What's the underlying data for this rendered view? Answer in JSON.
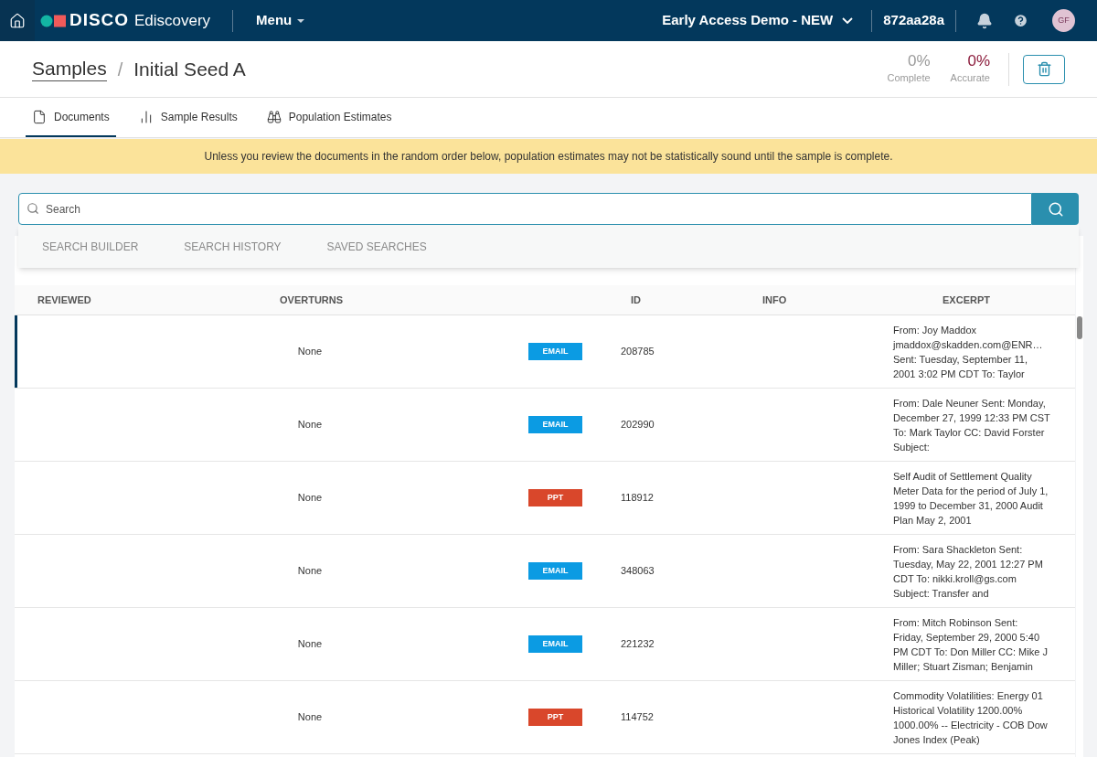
{
  "topbar": {
    "brand": "DISCO",
    "product": "Ediscovery",
    "menu": "Menu",
    "workspace": "Early Access Demo - NEW",
    "case_id": "872aa28a",
    "avatar": "GF"
  },
  "header": {
    "breadcrumb": "Samples",
    "separator": "/",
    "title": "Initial Seed A",
    "stats": [
      {
        "value": "0%",
        "label": "Complete",
        "kind": "neutral"
      },
      {
        "value": "0%",
        "label": "Accurate",
        "kind": "alert"
      }
    ]
  },
  "tabs": [
    {
      "label": "Documents",
      "selected": true
    },
    {
      "label": "Sample Results",
      "selected": false
    },
    {
      "label": "Population Estimates",
      "selected": false
    }
  ],
  "banner": "Unless you review the documents in the random order below, population estimates may not be statistically sound until the sample is complete.",
  "search": {
    "placeholder": "Search",
    "menu": [
      "SEARCH BUILDER",
      "SEARCH HISTORY",
      "SAVED SEARCHES"
    ]
  },
  "table": {
    "columns": [
      "REVIEWED",
      "OVERTURNS",
      "ID",
      "INFO",
      "EXCERPT"
    ],
    "rows": [
      {
        "overturns": "None",
        "type": "EMAIL",
        "kind": "email",
        "id": "208785",
        "excerpt": "From: Joy Maddox jmaddox@skadden.com@ENR… Sent: Tuesday, September 11, 2001 3:02 PM CDT To: Taylor",
        "selected": true
      },
      {
        "overturns": "None",
        "type": "EMAIL",
        "kind": "email",
        "id": "202990",
        "excerpt": "From: Dale Neuner Sent: Monday, December 27, 1999 12:33 PM CST To: Mark Taylor CC: David Forster Subject:",
        "selected": false
      },
      {
        "overturns": "None",
        "type": "PPT",
        "kind": "ppt",
        "id": "118912",
        "excerpt": "Self Audit of Settlement Quality Meter Data for the period of July 1, 1999 to December 31, 2000 Audit Plan May 2, 2001",
        "selected": false
      },
      {
        "overturns": "None",
        "type": "EMAIL",
        "kind": "email",
        "id": "348063",
        "excerpt": "From: Sara Shackleton Sent: Tuesday, May 22, 2001 12:27 PM CDT To: nikki.kroll@gs.com Subject: Transfer and",
        "selected": false
      },
      {
        "overturns": "None",
        "type": "EMAIL",
        "kind": "email",
        "id": "221232",
        "excerpt": "From: Mitch Robinson Sent: Friday, September 29, 2000 5:40 PM CDT To: Don Miller CC: Mike J Miller; Stuart Zisman; Benjamin",
        "selected": false
      },
      {
        "overturns": "None",
        "type": "PPT",
        "kind": "ppt",
        "id": "114752",
        "excerpt": "Commodity Volatilities: Energy 01 Historical Volatility 1200.00% 1000.00% -- Electricity - COB Dow Jones Index (Peak)",
        "selected": false
      }
    ]
  }
}
